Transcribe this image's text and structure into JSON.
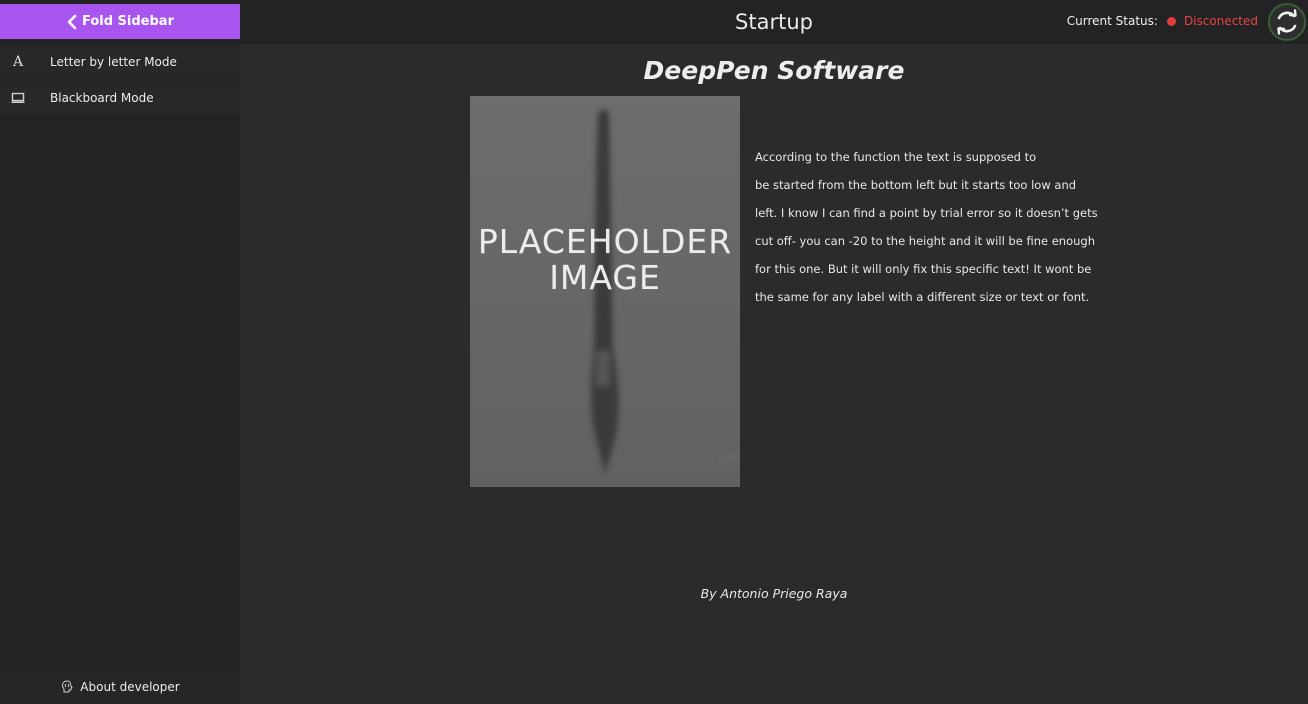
{
  "sidebar": {
    "fold_label": "Fold Sidebar",
    "items": [
      {
        "icon": "letter-a-icon",
        "icon_glyph": "A",
        "label": "Letter by letter Mode"
      },
      {
        "icon": "monitor-icon",
        "label": "Blackboard Mode"
      }
    ],
    "about_label": "About developer",
    "accent_color": "#a855f0"
  },
  "header": {
    "title": "Startup",
    "status_label": "Current Status:",
    "status_value": "Disconected",
    "status_color": "#e54545",
    "sync_icon": "refresh-icon"
  },
  "main": {
    "heading": "DeepPen Software",
    "image_caption_lines": [
      "PLACEHOLDER",
      "IMAGE"
    ],
    "paragraph_lines": [
      "According to the function the text is supposed to",
      "be started from the bottom left but it starts too low and",
      "left. I know I can find a point by trial error so it doesn’t gets",
      "cut off- you can -20 to the height and it will be fine enough",
      "for this one. But it will only fix this specific text! It wont be",
      "the same for any label with a different size or text or font."
    ],
    "byline": "By Antonio Priego Raya"
  }
}
